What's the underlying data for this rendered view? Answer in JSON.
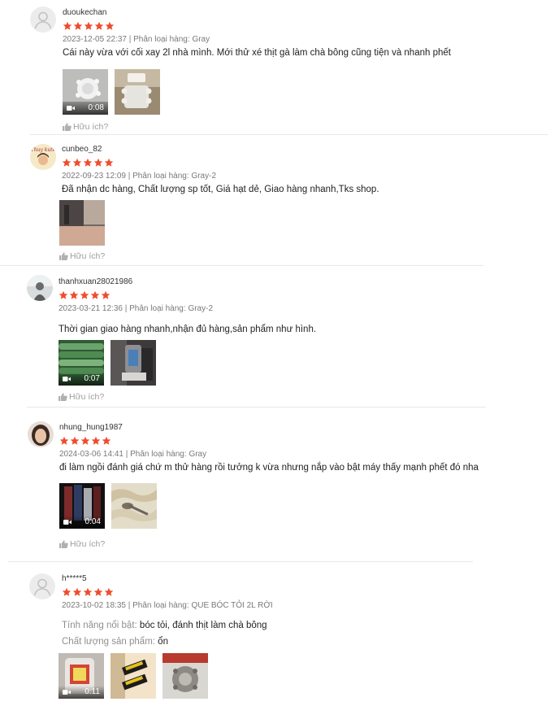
{
  "colors": {
    "star": "#ee4d2d",
    "meta": "#8a8a8a",
    "helpful": "#a0a0a0",
    "divider": "#e8e8e8"
  },
  "reviews": [
    {
      "username": "duoukechan",
      "rating": 5,
      "date": "2023-12-05 22:37",
      "separator": "|",
      "variation_label": "Phân loại hàng:",
      "variation": "Gray",
      "text": "Cái này vừa với cối xay 2l nhà mình. Mới thử xé thịt gà làm chà bông cũng tiện và nhanh phết",
      "media": [
        {
          "type": "video",
          "duration": "0:08"
        },
        {
          "type": "image"
        }
      ],
      "helpful_label": "Hữu ích?"
    },
    {
      "username": "cunbeo_82",
      "avatar_text": "Thuy kute",
      "rating": 5,
      "date": "2022-09-23 12:09",
      "separator": "|",
      "variation_label": "Phân loại hàng:",
      "variation": "Gray-2",
      "text": "Đã nhận dc hàng, Chất lượng sp tốt,  Giá hạt dẻ,  Giao hàng nhanh,Tks shop.",
      "media": [
        {
          "type": "image"
        }
      ],
      "helpful_label": "Hữu ích?"
    },
    {
      "username": "thanhxuan28021986",
      "rating": 5,
      "date": "2023-03-21 12:36",
      "separator": "|",
      "variation_label": "Phân loại hàng:",
      "variation": "Gray-2",
      "text": "Thời gian giao hàng nhanh,nhận đủ hàng,sản phẩm như hình.",
      "media": [
        {
          "type": "video",
          "duration": "0:07"
        },
        {
          "type": "image"
        }
      ],
      "helpful_label": "Hữu ích?"
    },
    {
      "username": "nhung_hung1987",
      "rating": 5,
      "date": "2024-03-06 14:41",
      "separator": "|",
      "variation_label": "Phân loại hàng:",
      "variation": "Gray",
      "text": "đi làm ngồi đánh giá chứ m thử hàng rồi tưởng k vừa nhưng nắp vào bật máy thấy mạnh phết đó nha",
      "media": [
        {
          "type": "video",
          "duration": "0:04"
        },
        {
          "type": "image"
        }
      ],
      "helpful_label": "Hữu ích?"
    },
    {
      "username": "h*****5",
      "rating": 5,
      "date": "2023-10-02 18:35",
      "separator": "|",
      "variation_label": "Phân loại hàng:",
      "variation": "QUE BÓC TỎI 2L RỜI",
      "attributes": [
        {
          "label": "Tính năng nổi bật:",
          "value": "bóc tỏi, đánh thịt làm chà bông"
        },
        {
          "label": "Chất lượng sản phẩm:",
          "value": "ổn"
        }
      ],
      "media": [
        {
          "type": "video",
          "duration": "0:11"
        },
        {
          "type": "image"
        },
        {
          "type": "image"
        }
      ]
    }
  ]
}
